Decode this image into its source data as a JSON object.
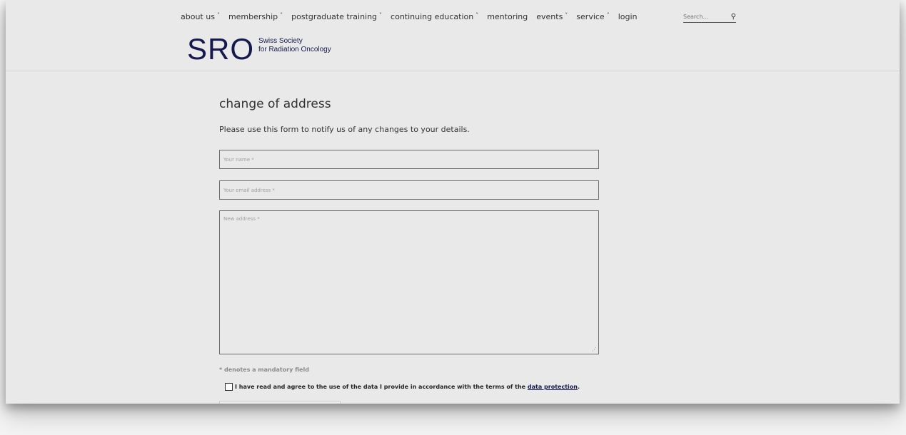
{
  "nav": {
    "items": [
      {
        "label": "about us",
        "has_dropdown": true
      },
      {
        "label": "membership",
        "has_dropdown": true
      },
      {
        "label": "postgraduate training",
        "has_dropdown": true
      },
      {
        "label": "continuing education",
        "has_dropdown": true
      },
      {
        "label": "mentoring",
        "has_dropdown": false
      },
      {
        "label": "events",
        "has_dropdown": true
      },
      {
        "label": "service",
        "has_dropdown": true
      },
      {
        "label": "login",
        "has_dropdown": false
      }
    ],
    "chevron": "˅"
  },
  "search": {
    "placeholder": "Search...",
    "icon": "search-icon"
  },
  "logo": {
    "mark": "SRO",
    "line1": "Swiss Society",
    "line2": "for Radiation Oncology",
    "color": "#15194d"
  },
  "form": {
    "title": "change of address",
    "intro": "Please use this form to notify us of any changes to your details.",
    "name_placeholder": "Your name *",
    "email_placeholder": "Your email address *",
    "address_placeholder": "New address *",
    "mandatory_note": "* denotes a mandatory field",
    "consent_text": "I have read and agree to the use of the data I provide in accordance with the terms of the",
    "consent_link": "data protection",
    "consent_end": "."
  }
}
